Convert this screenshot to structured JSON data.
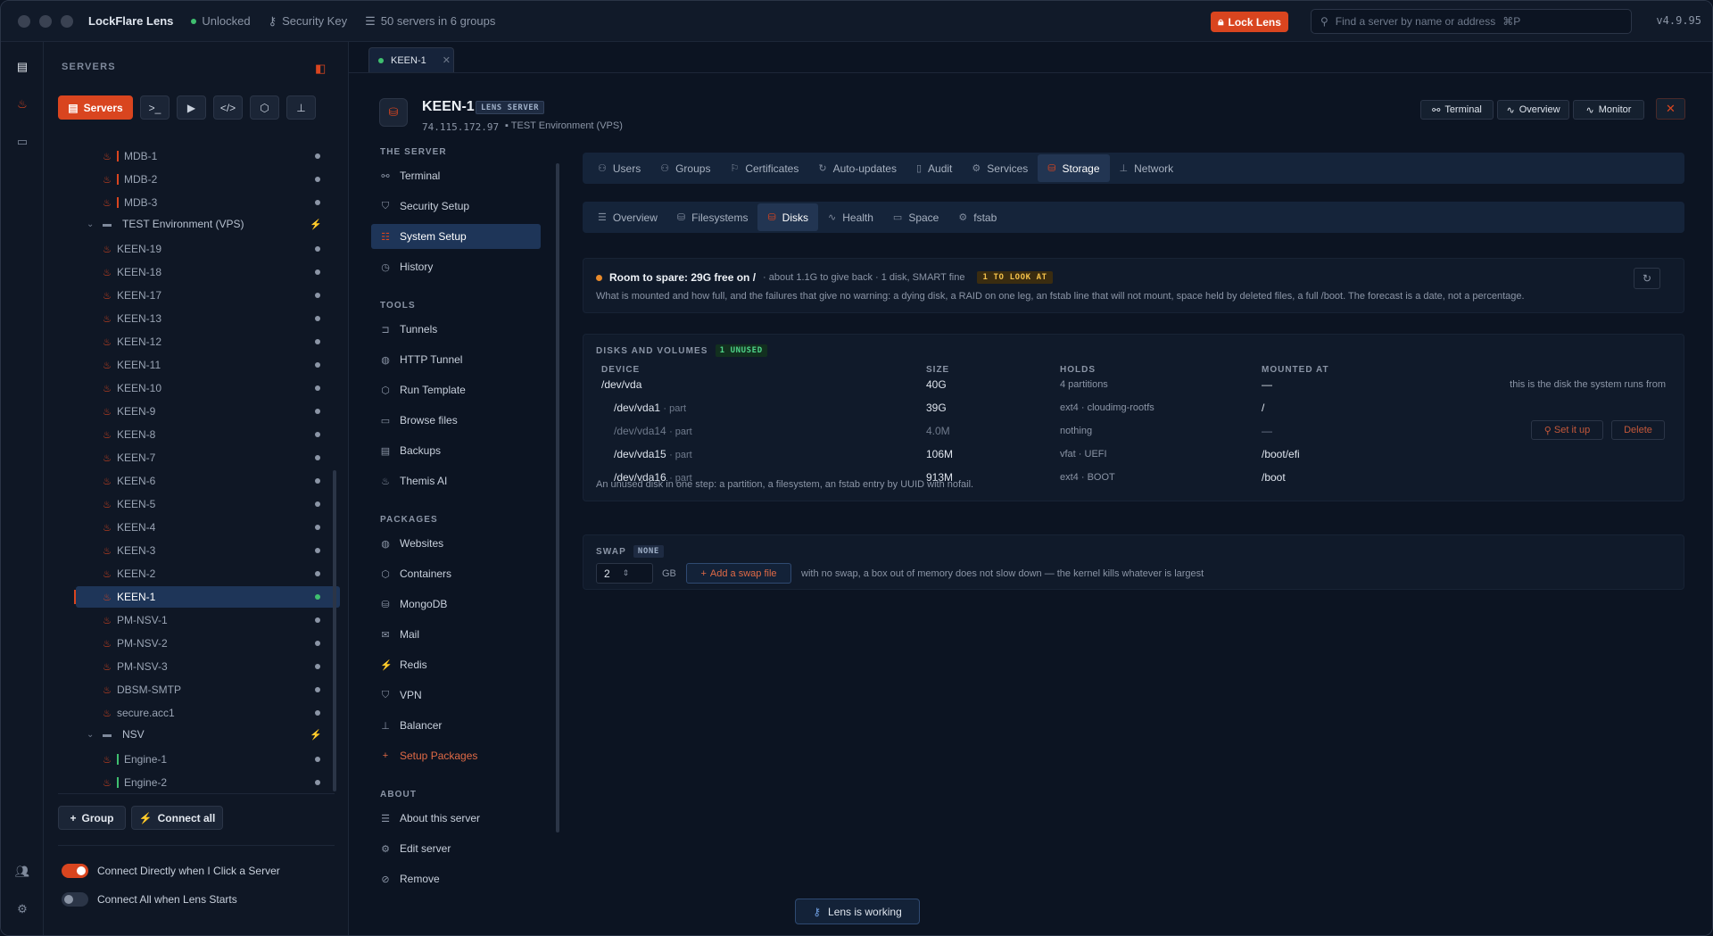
{
  "titlebar": {
    "app_name": "LockFlare Lens",
    "status": "Unlocked",
    "security_key": "Security Key",
    "servers_summary": "50 servers in 6 groups",
    "lock_button": "Lock Lens",
    "search_placeholder": "Find a server by name or address",
    "search_shortcut": "⌘P",
    "version": "v4.9.95"
  },
  "sidebar": {
    "heading": "SERVERS",
    "active_tab": "Servers",
    "tree": [
      {
        "kind": "server",
        "name": "MDB-1",
        "bar": "orange"
      },
      {
        "kind": "server",
        "name": "MDB-2",
        "bar": "orange"
      },
      {
        "kind": "server",
        "name": "MDB-3",
        "bar": "orange"
      },
      {
        "kind": "group",
        "name": "TEST Environment (VPS)"
      },
      {
        "kind": "server",
        "name": "KEEN-19"
      },
      {
        "kind": "server",
        "name": "KEEN-18"
      },
      {
        "kind": "server",
        "name": "KEEN-17"
      },
      {
        "kind": "server",
        "name": "KEEN-13"
      },
      {
        "kind": "server",
        "name": "KEEN-12"
      },
      {
        "kind": "server",
        "name": "KEEN-11"
      },
      {
        "kind": "server",
        "name": "KEEN-10"
      },
      {
        "kind": "server",
        "name": "KEEN-9"
      },
      {
        "kind": "server",
        "name": "KEEN-8"
      },
      {
        "kind": "server",
        "name": "KEEN-7"
      },
      {
        "kind": "server",
        "name": "KEEN-6"
      },
      {
        "kind": "server",
        "name": "KEEN-5"
      },
      {
        "kind": "server",
        "name": "KEEN-4"
      },
      {
        "kind": "server",
        "name": "KEEN-3"
      },
      {
        "kind": "server",
        "name": "KEEN-2"
      },
      {
        "kind": "server",
        "name": "KEEN-1",
        "selected": true
      },
      {
        "kind": "server",
        "name": "PM-NSV-1"
      },
      {
        "kind": "server",
        "name": "PM-NSV-2"
      },
      {
        "kind": "server",
        "name": "PM-NSV-3"
      },
      {
        "kind": "server",
        "name": "DBSM-SMTP"
      },
      {
        "kind": "server",
        "name": "secure.acc1"
      },
      {
        "kind": "group",
        "name": "NSV"
      },
      {
        "kind": "server",
        "name": "Engine-1",
        "bar": "green"
      },
      {
        "kind": "server",
        "name": "Engine-2",
        "bar": "green"
      }
    ],
    "group_button": "Group",
    "connect_all_button": "Connect all",
    "toggle_connect_directly": "Connect Directly when I Click a Server",
    "toggle_connect_all": "Connect All when Lens Starts",
    "toggle_connect_directly_on": true,
    "toggle_connect_all_on": false
  },
  "file_tab": {
    "label": "KEEN-1"
  },
  "server": {
    "name": "KEEN-1",
    "badge": "LENS SERVER",
    "ip": "74.115.172.97",
    "environment": "TEST Environment (VPS)",
    "buttons": {
      "terminal": "Terminal",
      "overview": "Overview",
      "monitor": "Monitor"
    }
  },
  "nav": {
    "sections": [
      {
        "title": "THE SERVER",
        "items": [
          {
            "label": "Terminal",
            "icon": "link-icon"
          },
          {
            "label": "Security Setup",
            "icon": "shield-icon"
          },
          {
            "label": "System Setup",
            "icon": "sliders-icon",
            "selected": true
          },
          {
            "label": "History",
            "icon": "clock-icon"
          }
        ]
      },
      {
        "title": "TOOLS",
        "items": [
          {
            "label": "Tunnels",
            "icon": "tunnel-icon"
          },
          {
            "label": "HTTP Tunnel",
            "icon": "globe-icon"
          },
          {
            "label": "Run Template",
            "icon": "box-icon"
          },
          {
            "label": "Browse files",
            "icon": "folder-icon"
          },
          {
            "label": "Backups",
            "icon": "archive-icon"
          },
          {
            "label": "Themis AI",
            "icon": "flame-icon"
          }
        ]
      },
      {
        "title": "PACKAGES",
        "items": [
          {
            "label": "Websites",
            "icon": "globe-icon"
          },
          {
            "label": "Containers",
            "icon": "box-icon"
          },
          {
            "label": "MongoDB",
            "icon": "database-icon"
          },
          {
            "label": "Mail",
            "icon": "mail-icon"
          },
          {
            "label": "Redis",
            "icon": "bolt-icon"
          },
          {
            "label": "VPN",
            "icon": "shield-icon"
          },
          {
            "label": "Balancer",
            "icon": "network-icon"
          },
          {
            "label": "Setup Packages",
            "icon": "plus-icon",
            "accent": true
          }
        ]
      },
      {
        "title": "ABOUT",
        "items": [
          {
            "label": "About this server",
            "icon": "list-icon"
          },
          {
            "label": "Edit server",
            "icon": "gear-icon"
          },
          {
            "label": "Remove",
            "icon": "ban-icon"
          }
        ]
      }
    ]
  },
  "top_tabs": [
    {
      "label": "Users",
      "icon": "user-icon"
    },
    {
      "label": "Groups",
      "icon": "users-icon"
    },
    {
      "label": "Certificates",
      "icon": "ribbon-icon"
    },
    {
      "label": "Auto-updates",
      "icon": "refresh-icon"
    },
    {
      "label": "Audit",
      "icon": "document-icon"
    },
    {
      "label": "Services",
      "icon": "gear-icon"
    },
    {
      "label": "Storage",
      "icon": "database-icon",
      "selected": true
    },
    {
      "label": "Network",
      "icon": "network-icon"
    }
  ],
  "sub_tabs": [
    {
      "label": "Overview",
      "icon": "list-icon"
    },
    {
      "label": "Filesystems",
      "icon": "database-icon"
    },
    {
      "label": "Disks",
      "icon": "disk-icon",
      "selected": true
    },
    {
      "label": "Health",
      "icon": "pulse-icon"
    },
    {
      "label": "Space",
      "icon": "folder-icon"
    },
    {
      "label": "fstab",
      "icon": "gear-icon"
    }
  ],
  "summary": {
    "headline": "Room to spare: 29G free on /",
    "detail": "· about 1.1G to give back · 1 disk, SMART fine",
    "badge": "1 TO LOOK AT",
    "description": "What is mounted and how full, and the failures that give no warning: a dying disk, a RAID on one leg, an fstab line that will not mount, space held by deleted files, a full /boot. The forecast is a date, not a percentage."
  },
  "disks": {
    "title": "DISKS AND VOLUMES",
    "badge": "1 UNUSED",
    "columns": [
      "DEVICE",
      "SIZE",
      "HOLDS",
      "MOUNTED AT"
    ],
    "rows": [
      {
        "device": "/dev/vda",
        "part": "",
        "size": "40G",
        "holds": "4 partitions",
        "mount": "—",
        "note": "this is the disk the system runs from"
      },
      {
        "device": "/dev/vda1",
        "part": "· part",
        "size": "39G",
        "holds": "ext4 · cloudimg-rootfs",
        "mount": "/",
        "note": ""
      },
      {
        "device": "/dev/vda14",
        "part": "· part",
        "size": "4.0M",
        "holds": "nothing",
        "mount": "—",
        "note": "",
        "unused": true
      },
      {
        "device": "/dev/vda15",
        "part": "· part",
        "size": "106M",
        "holds": "vfat · UEFI",
        "mount": "/boot/efi",
        "note": ""
      },
      {
        "device": "/dev/vda16",
        "part": "· part",
        "size": "913M",
        "holds": "ext4 · BOOT",
        "mount": "/boot",
        "note": ""
      }
    ],
    "set_it_up": "Set it up",
    "delete": "Delete",
    "footer": "An unused disk in one step: a partition, a filesystem, an fstab entry by UUID with nofail."
  },
  "swap": {
    "title": "SWAP",
    "badge": "NONE",
    "value": "2",
    "unit": "GB",
    "add_button": "Add a swap file",
    "note": "with no swap, a box out of memory does not slow down — the kernel kills whatever is largest"
  },
  "status": {
    "working": "Lens is working"
  },
  "colors": {
    "accent": "#d9451f",
    "selected": "#1e3558",
    "ok": "#3fbf6f",
    "warn": "#f3c14a"
  }
}
